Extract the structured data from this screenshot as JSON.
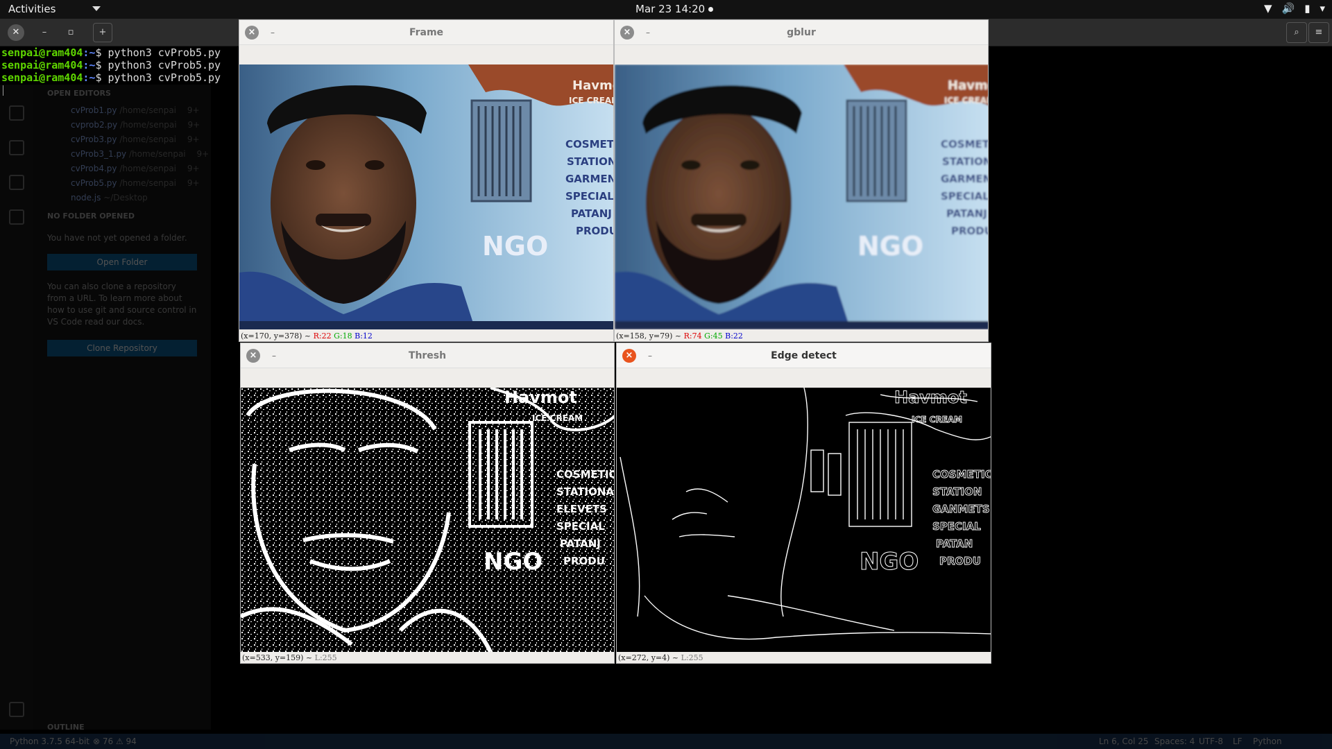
{
  "topbar": {
    "activities": "Activities",
    "clock": "Mar 23  14:20"
  },
  "terminal": {
    "lines": [
      {
        "user": "senpai@ram404",
        "path": ":~",
        "cmd": "$ python3 cvProb5.py"
      },
      {
        "user": "senpai@ram404",
        "path": ":~",
        "cmd": "$ python3 cvProb5.py"
      },
      {
        "user": "senpai@ram404",
        "path": ":~",
        "cmd": "$ python3 cvProb5.py"
      }
    ]
  },
  "vscode": {
    "open_editors": "OPEN EDITORS",
    "files": [
      {
        "name": "cvProb1.py",
        "dir": "/home/senpai",
        "badge": "9+"
      },
      {
        "name": "cvprob2.py",
        "dir": "/home/senpai",
        "badge": "9+"
      },
      {
        "name": "cvProb3.py",
        "dir": "/home/senpai",
        "badge": "9+"
      },
      {
        "name": "cvProb3_1.py",
        "dir": "/home/senpai",
        "badge": "9+"
      },
      {
        "name": "cvProb4.py",
        "dir": "/home/senpai",
        "badge": "9+"
      },
      {
        "name": "cvProb5.py",
        "dir": "/home/senpai",
        "badge": "9+"
      },
      {
        "name": "node.js",
        "dir": "~/Desktop",
        "badge": ""
      }
    ],
    "no_folder": "NO FOLDER OPENED",
    "no_folder_text": "You have not yet opened a folder.",
    "open_folder": "Open Folder",
    "clone_text": "You can also clone a repository from a URL. To learn more about how to use git and source control in VS Code read our docs.",
    "clone_button": "Clone Repository",
    "outline": "OUTLINE",
    "status": {
      "python": "Python 3.7.5 64-bit",
      "problems": "⊗ 76 ⚠ 94",
      "position": "Ln 6, Col 25",
      "spaces": "Spaces: 4",
      "encoding": "UTF-8",
      "eol": "LF",
      "language": "Python"
    }
  },
  "windows": {
    "frame": {
      "title": "Frame",
      "xy": "(x=170, y=378) ~ ",
      "r": "R:22",
      "g": "G:18",
      "b": "B:12"
    },
    "gblur": {
      "title": "gblur",
      "xy": "(x=158, y=79) ~ ",
      "r": "R:74",
      "g": "G:45",
      "b": "B:22"
    },
    "thresh": {
      "title": "Thresh",
      "xy": "(x=533, y=159) ~ ",
      "l": "L:255"
    },
    "edge": {
      "title": "Edge detect",
      "xy": "(x=272, y=4) ~ ",
      "l": "L:255"
    }
  }
}
